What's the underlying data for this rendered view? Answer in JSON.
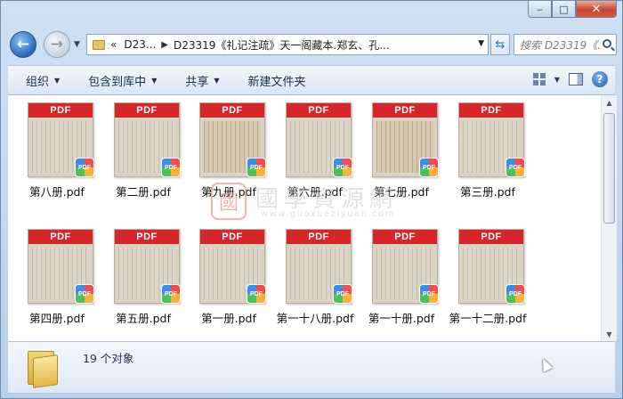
{
  "window": {
    "minimize_glyph": "‒",
    "maximize_glyph": "□",
    "close_glyph": "✕"
  },
  "nav": {
    "back_glyph": "←",
    "forward_glyph": "→",
    "address_prefix": "«",
    "breadcrumb": [
      "D23...",
      "D23319《礼记注疏》天一阁藏本.郑玄、孔..."
    ],
    "search_placeholder": "搜索 D23319《..."
  },
  "toolbar": {
    "items": [
      {
        "label": "组织",
        "has_menu": true
      },
      {
        "label": "包含到库中",
        "has_menu": true
      },
      {
        "label": "共享",
        "has_menu": true
      },
      {
        "label": "新建文件夹",
        "has_menu": false
      }
    ]
  },
  "files": [
    {
      "name": "第八册.pdf",
      "banner": "PDF",
      "badge": "PDF",
      "tone": "neutral"
    },
    {
      "name": "第二册.pdf",
      "banner": "PDF",
      "badge": "PDF",
      "tone": "neutral"
    },
    {
      "name": "第九册.pdf",
      "banner": "PDF",
      "badge": "PDF",
      "tone": "warm"
    },
    {
      "name": "第六册.pdf",
      "banner": "PDF",
      "badge": "PDF",
      "tone": "neutral"
    },
    {
      "name": "第七册.pdf",
      "banner": "PDF",
      "badge": "PDF",
      "tone": "warm"
    },
    {
      "name": "第三册.pdf",
      "banner": "PDF",
      "badge": "PDF",
      "tone": "neutral"
    },
    {
      "name": "第四册.pdf",
      "banner": "PDF",
      "badge": "PDF",
      "tone": "neutral"
    },
    {
      "name": "第五册.pdf",
      "banner": "PDF",
      "badge": "PDF",
      "tone": "neutral"
    },
    {
      "name": "第一册.pdf",
      "banner": "PDF",
      "badge": "PDF",
      "tone": "neutral"
    },
    {
      "name": "第一十八册.pdf",
      "banner": "PDF",
      "badge": "PDF",
      "tone": "neutral"
    },
    {
      "name": "第一十册.pdf",
      "banner": "PDF",
      "badge": "PDF",
      "tone": "neutral"
    },
    {
      "name": "第一十二册.pdf",
      "banner": "PDF",
      "badge": "PDF",
      "tone": "neutral"
    }
  ],
  "watermark": {
    "seal": "國",
    "text": "國學資源網",
    "url": "www.guoxueziyuan.com"
  },
  "status": {
    "count_text": "19 个对象"
  },
  "colors": {
    "pdf_banner": "#d7262a",
    "window_chrome": "#b9d0ea",
    "close_button": "#c8452f"
  }
}
